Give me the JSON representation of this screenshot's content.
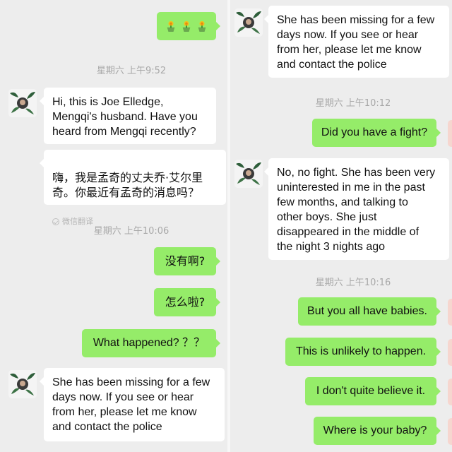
{
  "colors": {
    "incoming_bubble": "#ffffff",
    "outgoing_bubble": "#95ec69",
    "background": "#ededed",
    "timestamp_text": "#a8a8a8"
  },
  "left": {
    "emoji_message": {
      "icons": [
        "flower-pot-emoji",
        "flower-pot-emoji",
        "flower-pot-emoji"
      ]
    },
    "timestamp_1": "星期六 上午9:52",
    "message_1": "Hi, this is Joe Elledge,\nMengqi's husband. Have you\nheard from Mengqi recently?",
    "translation": {
      "text": "嗨，我是孟奇的丈夫乔·艾尔里\n奇。你最近有孟奇的消息吗？",
      "note": "微信翻译"
    },
    "timestamp_2": "星期六 上午10:06",
    "reply_1": "没有啊?",
    "reply_2": "怎么啦?",
    "reply_3": "What happened? ？？",
    "message_2": "She has been missing for a few\n days now. If you see or hear\nfrom her, please let me know\nand contact the police"
  },
  "right": {
    "message_1": "She has been missing for a few\n days now. If you see or hear\nfrom her, please let me know\nand contact the police",
    "timestamp_1": "星期六 上午10:12",
    "reply_1": "Did you have a fight?",
    "message_2": "No, no fight. She has been very\n uninterested in me in the past\nfew months, and talking to\nother boys. She just\ndisappeared in the middle of\nthe night 3 nights ago",
    "timestamp_2": "星期六 上午10:16",
    "reply_2": "But you all have babies.",
    "reply_3": "This is unlikely to happen.",
    "reply_4": "I don't quite believe it.",
    "reply_5": "Where is your baby?"
  }
}
